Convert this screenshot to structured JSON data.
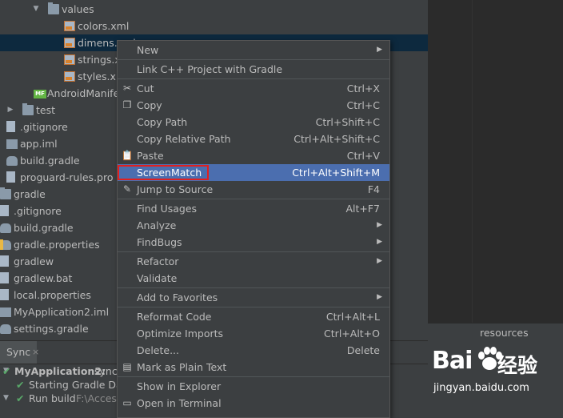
{
  "tree": [
    {
      "label": "values",
      "icon": "folder-icon",
      "expanded": true
    },
    {
      "label": "colors.xml",
      "icon": "xml-file-icon"
    },
    {
      "label": "dimens.xml",
      "icon": "xml-file-icon",
      "selected": true
    },
    {
      "label": "strings.xml",
      "icon": "xml-file-icon"
    },
    {
      "label": "styles.xml",
      "icon": "xml-file-icon"
    },
    {
      "label": "AndroidManifest.xml",
      "icon": "manifest-icon"
    },
    {
      "label": "test",
      "icon": "folder-icon",
      "expanded": false
    },
    {
      "label": ".gitignore",
      "icon": "file-icon"
    },
    {
      "label": "app.iml",
      "icon": "iml-file-icon"
    },
    {
      "label": "build.gradle",
      "icon": "gradle-icon"
    },
    {
      "label": "proguard-rules.pro",
      "icon": "file-icon"
    },
    {
      "label": "gradle",
      "icon": "folder-icon"
    },
    {
      "label": ".gitignore",
      "icon": "file-icon"
    },
    {
      "label": "build.gradle",
      "icon": "gradle-icon"
    },
    {
      "label": "gradle.properties",
      "icon": "gradle-icon"
    },
    {
      "label": "gradlew",
      "icon": "file-icon"
    },
    {
      "label": "gradlew.bat",
      "icon": "file-icon"
    },
    {
      "label": "local.properties",
      "icon": "file-icon"
    },
    {
      "label": "MyApplication2.iml",
      "icon": "iml-file-icon"
    },
    {
      "label": "settings.gradle",
      "icon": "gradle-icon"
    }
  ],
  "editor": {
    "footer_label": "resources"
  },
  "bottom": {
    "tab": "Sync",
    "close": "×",
    "lines": [
      {
        "bold": "MyApplication2:",
        "text": " sync"
      },
      {
        "text": "Starting Gradle Dae"
      },
      {
        "text": "Run build ",
        "path": "F:\\Access"
      }
    ]
  },
  "menu": {
    "items": [
      {
        "label": "New",
        "submenu": true
      },
      {
        "sep": true
      },
      {
        "label": "Link C++ Project with Gradle"
      },
      {
        "sep": true
      },
      {
        "label": "Cut",
        "shortcut": "Ctrl+X",
        "icon": "scissors-icon",
        "glyph": "✂"
      },
      {
        "label": "Copy",
        "shortcut": "Ctrl+C",
        "icon": "copy-icon",
        "glyph": "❐"
      },
      {
        "label": "Copy Path",
        "shortcut": "Ctrl+Shift+C"
      },
      {
        "label": "Copy Relative Path",
        "shortcut": "Ctrl+Alt+Shift+C"
      },
      {
        "label": "Paste",
        "shortcut": "Ctrl+V",
        "icon": "paste-icon",
        "glyph": "📋"
      },
      {
        "label": "ScreenMatch",
        "shortcut": "Ctrl+Alt+Shift+M",
        "highlighted": true
      },
      {
        "label": "Jump to Source",
        "shortcut": "F4",
        "icon": "pencil-icon",
        "glyph": "✎"
      },
      {
        "sep": true
      },
      {
        "label": "Find Usages",
        "shortcut": "Alt+F7"
      },
      {
        "label": "Analyze",
        "submenu": true
      },
      {
        "label": "FindBugs",
        "submenu": true
      },
      {
        "sep": true
      },
      {
        "label": "Refactor",
        "submenu": true
      },
      {
        "label": "Validate"
      },
      {
        "sep": true
      },
      {
        "label": "Add to Favorites",
        "submenu": true
      },
      {
        "sep": true
      },
      {
        "label": "Reformat Code",
        "shortcut": "Ctrl+Alt+L"
      },
      {
        "label": "Optimize Imports",
        "shortcut": "Ctrl+Alt+O"
      },
      {
        "label": "Delete...",
        "shortcut": "Delete"
      },
      {
        "label": "Mark as Plain Text",
        "icon": "plain-text-icon",
        "glyph": "▤"
      },
      {
        "sep": true
      },
      {
        "label": "Show in Explorer"
      },
      {
        "label": "Open in Terminal",
        "icon": "terminal-icon",
        "glyph": "▭"
      }
    ]
  },
  "watermark": {
    "logo": "Bai",
    "logo2": "经验",
    "url": "jingyan.baidu.com"
  },
  "colors": {
    "highlight": "#4b6eaf",
    "selection": "#0d293e",
    "annotation": "#e02020"
  }
}
